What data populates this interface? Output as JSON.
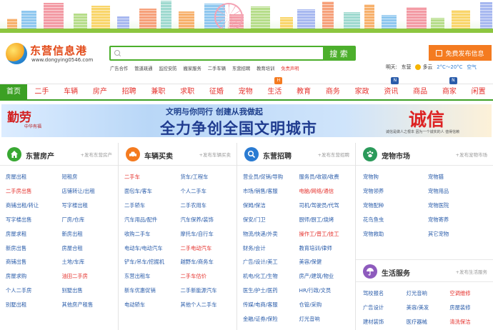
{
  "site": {
    "name": "东营信息港",
    "domain": "www.dongying0546.com"
  },
  "search": {
    "placeholder": "",
    "button": "搜 索",
    "hot_links": [
      {
        "label": "广告合作",
        "red": false
      },
      {
        "label": "管道疏通",
        "red": false
      },
      {
        "label": "监控安防",
        "red": false
      },
      {
        "label": "搬家服务",
        "red": false
      },
      {
        "label": "二手车辆",
        "red": false
      },
      {
        "label": "东营招聘",
        "red": false
      },
      {
        "label": "教育培训",
        "red": false
      },
      {
        "label": "免责声明",
        "red": true
      }
    ]
  },
  "post_button": "免费发布信息",
  "weather": {
    "label": "明天:",
    "city": "东营",
    "condition": "多云",
    "temp": "2°C～20°C",
    "air": "空气"
  },
  "nav": [
    {
      "label": "首页",
      "badge": ""
    },
    {
      "label": "二手",
      "badge": ""
    },
    {
      "label": "车辆",
      "badge": ""
    },
    {
      "label": "房产",
      "badge": ""
    },
    {
      "label": "招聘",
      "badge": ""
    },
    {
      "label": "兼职",
      "badge": ""
    },
    {
      "label": "求职",
      "badge": ""
    },
    {
      "label": "征婚",
      "badge": ""
    },
    {
      "label": "宠物",
      "badge": ""
    },
    {
      "label": "生活",
      "badge": "H"
    },
    {
      "label": "教育",
      "badge": ""
    },
    {
      "label": "商务",
      "badge": ""
    },
    {
      "label": "家政",
      "badge": ""
    },
    {
      "label": "资讯",
      "badge": "N"
    },
    {
      "label": "商品",
      "badge": ""
    },
    {
      "label": "商家",
      "badge": "N"
    },
    {
      "label": "闲置",
      "badge": ""
    }
  ],
  "banner": {
    "left_main": "勤劳",
    "left_sub": "中华有福",
    "slogan_small": "文明与你同行  创建从我做起",
    "slogan_big": "全力争创全国文明城市",
    "right_main": "诚信",
    "right_sub": "诚信是做人之根本 因为一个诚实的人 值得信赖"
  },
  "panels": {
    "house": {
      "title": "东营房产",
      "post": "+发布东营房产",
      "items": [
        {
          "label": "房屋出租",
          "style": ""
        },
        {
          "label": "短租房",
          "style": ""
        },
        {
          "label": "二手房出售",
          "style": "red"
        },
        {
          "label": "店铺转让/出租",
          "style": ""
        },
        {
          "label": "商铺出租/转让",
          "style": ""
        },
        {
          "label": "写字楼出租",
          "style": ""
        },
        {
          "label": "写字楼出售",
          "style": ""
        },
        {
          "label": "厂房/仓库",
          "style": ""
        },
        {
          "label": "房屋求租",
          "style": ""
        },
        {
          "label": "新房出租",
          "style": ""
        },
        {
          "label": "新房出售",
          "style": ""
        },
        {
          "label": "房屋合租",
          "style": ""
        },
        {
          "label": "商铺出售",
          "style": ""
        },
        {
          "label": "土地/车库",
          "style": ""
        },
        {
          "label": "房屋求购",
          "style": ""
        },
        {
          "label": "油田二手房",
          "style": "red"
        },
        {
          "label": "个人二手房",
          "style": ""
        },
        {
          "label": "别墅出售",
          "style": ""
        },
        {
          "label": "别墅出租",
          "style": ""
        },
        {
          "label": "其他房产租售",
          "style": ""
        }
      ]
    },
    "car": {
      "title": "车辆买卖",
      "post": "+发布车辆买卖",
      "items": [
        {
          "label": "二手车",
          "style": "red"
        },
        {
          "label": "货车/工程车",
          "style": ""
        },
        {
          "label": "面包车/客车",
          "style": ""
        },
        {
          "label": "个人二手车",
          "style": ""
        },
        {
          "label": "二手轿车",
          "style": ""
        },
        {
          "label": "二手农用车",
          "style": ""
        },
        {
          "label": "汽车用品/配件",
          "style": ""
        },
        {
          "label": "汽车保养/装饰",
          "style": ""
        },
        {
          "label": "收购二手车",
          "style": ""
        },
        {
          "label": "摩托车/自行车",
          "style": ""
        },
        {
          "label": "电动车/电动汽车",
          "style": ""
        },
        {
          "label": "二手电动汽车",
          "style": "red"
        },
        {
          "label": "铲车/吊车/挖掘机",
          "style": ""
        },
        {
          "label": "越野车/商务车",
          "style": ""
        },
        {
          "label": "东营出租车",
          "style": ""
        },
        {
          "label": "二手车估价",
          "style": "red"
        },
        {
          "label": "新车优惠促销",
          "style": ""
        },
        {
          "label": "二手新能源汽车",
          "style": ""
        },
        {
          "label": "电动轿车",
          "style": ""
        },
        {
          "label": "其他个人二手车",
          "style": ""
        }
      ]
    },
    "job": {
      "title": "东营招聘",
      "post": "+发布东营招聘",
      "items": [
        {
          "label": "营业员/促销/导购",
          "style": ""
        },
        {
          "label": "服务员/收银/收费",
          "style": ""
        },
        {
          "label": "市场/销售/客服",
          "style": ""
        },
        {
          "label": "电脑/网络/通信",
          "style": "red"
        },
        {
          "label": "保姆/保洁",
          "style": ""
        },
        {
          "label": "司机/驾驶员/代驾",
          "style": ""
        },
        {
          "label": "保安/门卫",
          "style": ""
        },
        {
          "label": "厨师/厨工/烧烤",
          "style": ""
        },
        {
          "label": "物流/快递/外卖",
          "style": ""
        },
        {
          "label": "操作工/普工/技工",
          "style": "red"
        },
        {
          "label": "财务/会计",
          "style": ""
        },
        {
          "label": "教育培训/律师",
          "style": ""
        },
        {
          "label": "广告/设计/美工",
          "style": ""
        },
        {
          "label": "美容/保健",
          "style": ""
        },
        {
          "label": "机电/化工/生物",
          "style": ""
        },
        {
          "label": "房产/建筑/物业",
          "style": ""
        },
        {
          "label": "医生/护士/医药",
          "style": ""
        },
        {
          "label": "HR/行政/文员",
          "style": ""
        },
        {
          "label": "传媒/电商/客服",
          "style": ""
        },
        {
          "label": "仓管/采购",
          "style": ""
        },
        {
          "label": "金融/证券/保险",
          "style": ""
        },
        {
          "label": "灯光音响",
          "style": ""
        }
      ]
    },
    "pet": {
      "title": "宠物市场",
      "post": "+发布宠物市场",
      "items": [
        {
          "label": "宠物狗",
          "style": ""
        },
        {
          "label": "宠物猫",
          "style": ""
        },
        {
          "label": "宠物领养",
          "style": ""
        },
        {
          "label": "宠物用品",
          "style": ""
        },
        {
          "label": "宠物配种",
          "style": ""
        },
        {
          "label": "宠物医院",
          "style": ""
        },
        {
          "label": "花鸟鱼虫",
          "style": ""
        },
        {
          "label": "宠物寄养",
          "style": ""
        },
        {
          "label": "宠物救助",
          "style": "green"
        },
        {
          "label": "其它宠物",
          "style": ""
        }
      ]
    },
    "life": {
      "title": "生活服务",
      "post": "+发布生活服务",
      "items": [
        {
          "label": "驾校报名",
          "style": ""
        },
        {
          "label": "灯光音响",
          "style": ""
        },
        {
          "label": "空调维修",
          "style": "red"
        },
        {
          "label": "广告设计",
          "style": ""
        },
        {
          "label": "美容/美发",
          "style": ""
        },
        {
          "label": "房屋装修",
          "style": ""
        },
        {
          "label": "建材装饰",
          "style": ""
        },
        {
          "label": "医疗器械",
          "style": ""
        },
        {
          "label": "清洗保洁",
          "style": "red"
        }
      ]
    }
  }
}
